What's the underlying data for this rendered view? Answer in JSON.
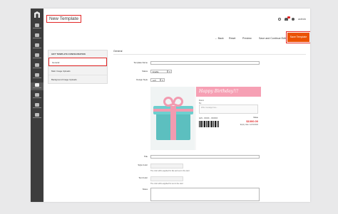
{
  "header": {
    "page_title": "New Template",
    "user_name": "admin"
  },
  "toolbar": {
    "back": "← Back",
    "reset": "Reset",
    "preview": "Preview",
    "save_continue": "Save and Continue Edit",
    "save_template": "Save Template"
  },
  "panel": {
    "title": "GIFT TEMPLATE CONFIGURATION",
    "items": [
      {
        "label": "General"
      },
      {
        "label": "Main Image Uploads"
      },
      {
        "label": "Background Image Uploads"
      }
    ]
  },
  "form": {
    "section_title": "General",
    "template_name_label": "Template Name",
    "status_label": "Status",
    "status_value": "Enable",
    "design_style_label": "Design Style",
    "design_style_value": "Left",
    "title_label": "Title",
    "style_color_label": "Style Color",
    "style_color_note": "The color will be applied for title and text in the card",
    "text_color_label": "Text Color",
    "text_color_note": "The color will be applied for text in the card",
    "notes_label": "Notes"
  },
  "card": {
    "greeting": "Happy Birthday!!!",
    "from_label": "From:",
    "to_label": "To:",
    "message_placeholder": "Write message here...",
    "code_text": "GIfI - XXXX - XXXXX",
    "value_label": "Value",
    "value_amount": "$1000.00",
    "expiry_text": "Expiry date: 12/31/2024"
  },
  "colors": {
    "accent": "#eb5202",
    "highlight_border": "#e22626",
    "sidebar": "#3d3d3d",
    "card_header": "#f6a0b4"
  },
  "icons": {
    "logo": "magento-logo-icon",
    "search": "search-icon",
    "bell": "bell-icon",
    "user": "user-icon"
  }
}
